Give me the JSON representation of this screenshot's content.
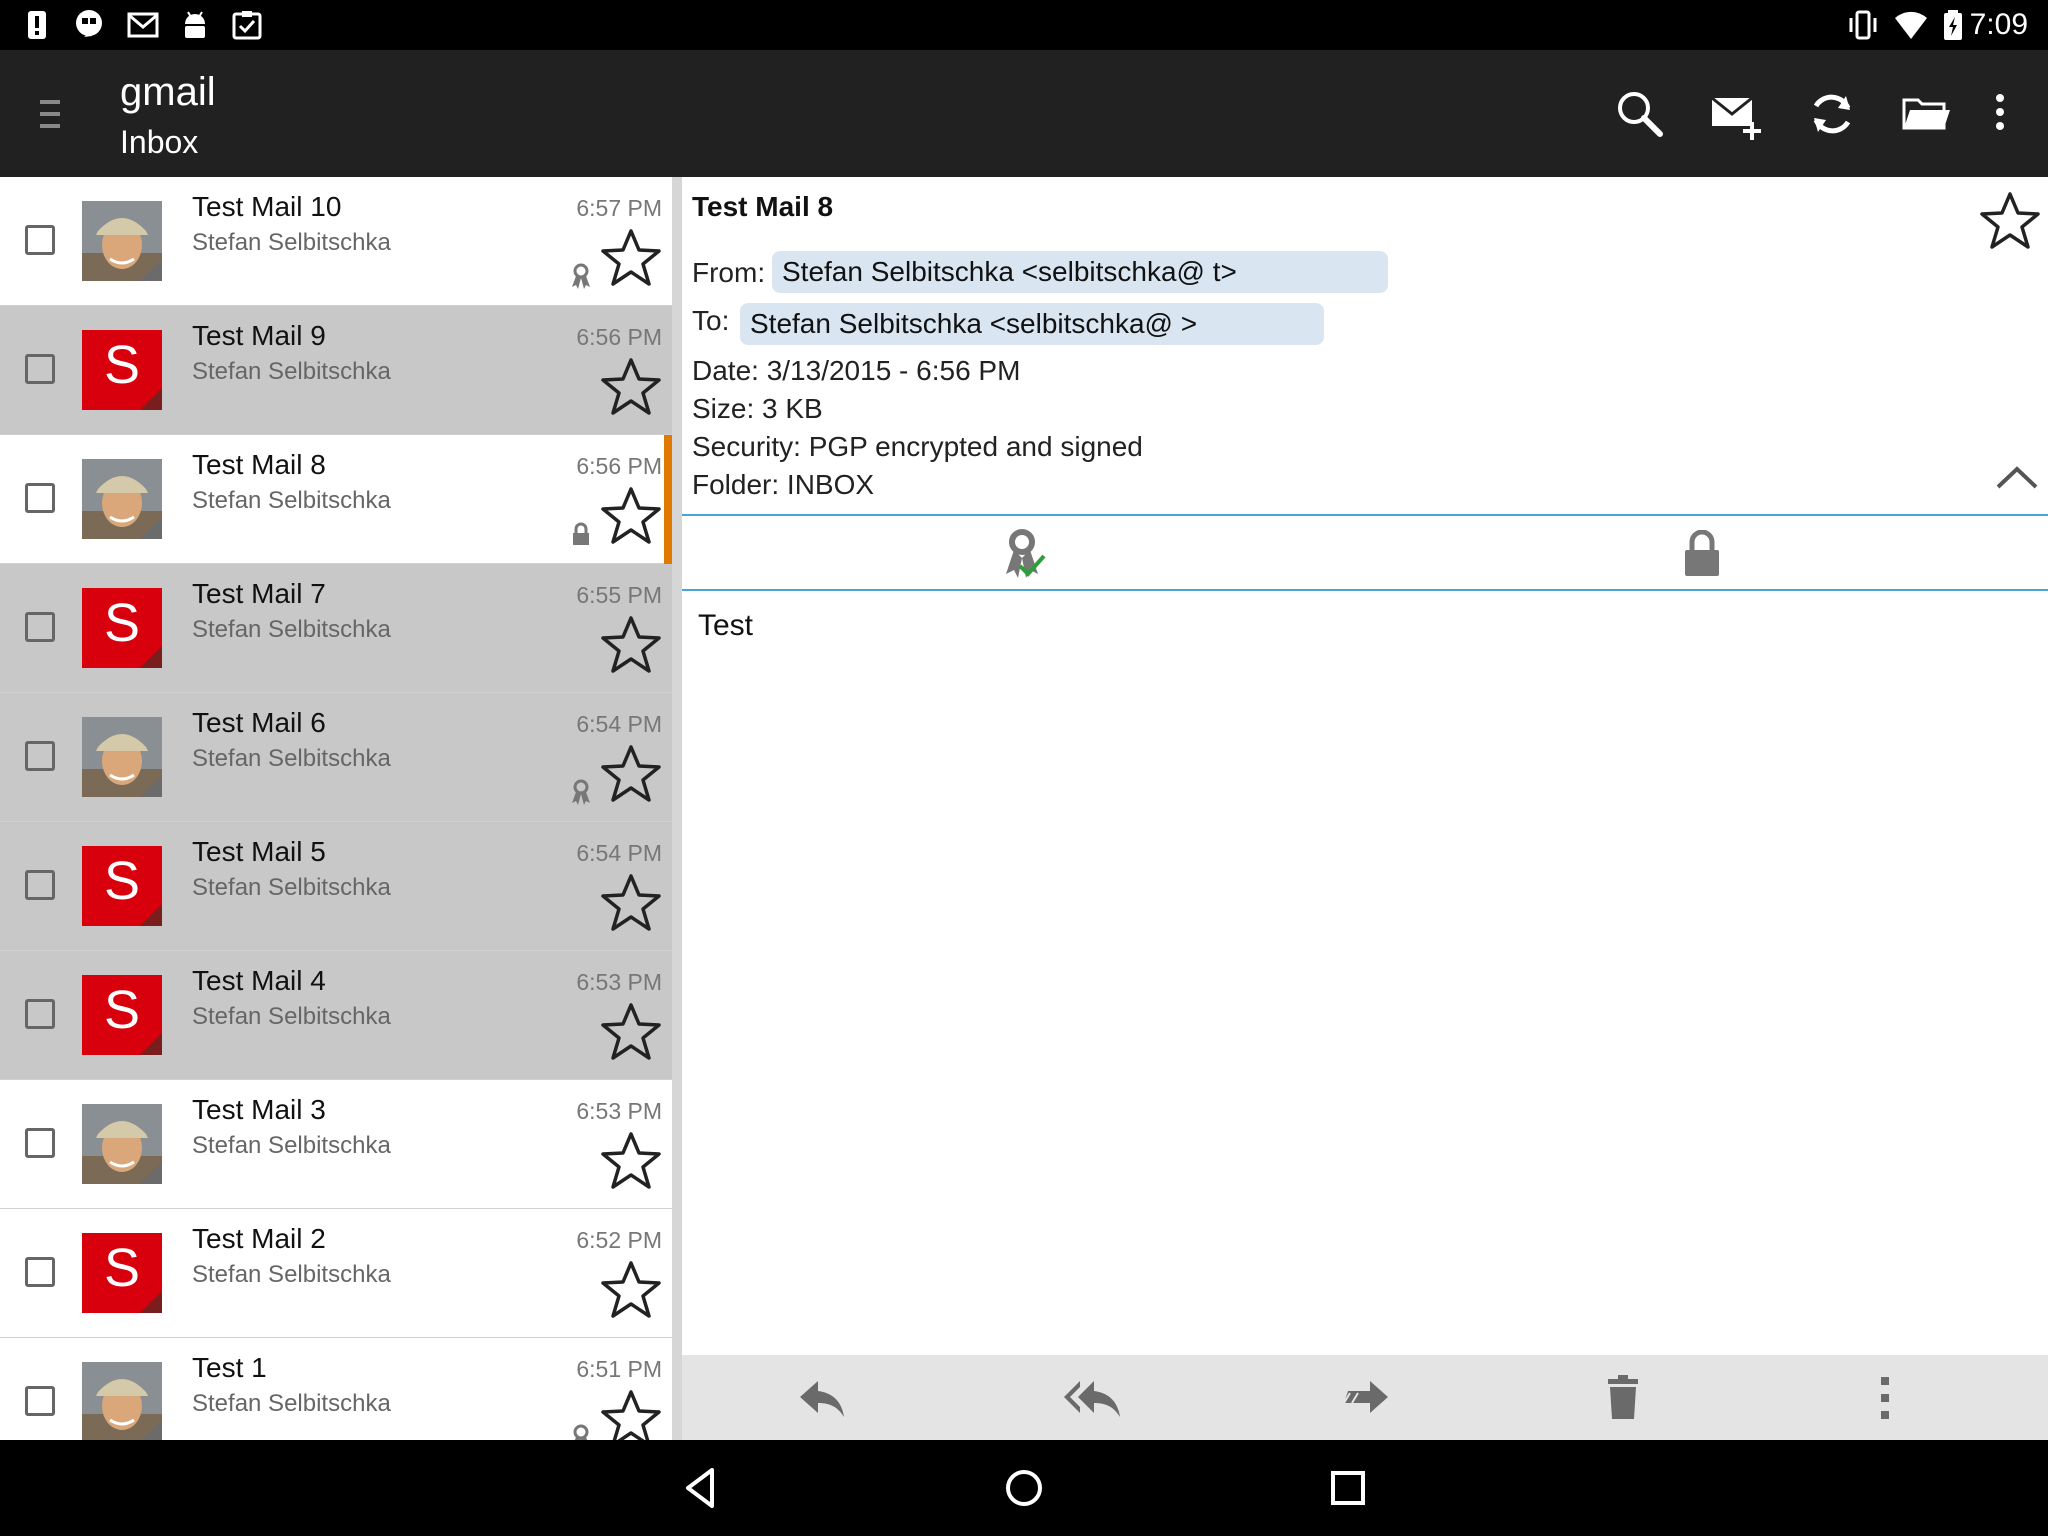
{
  "status_bar": {
    "time": "7:09",
    "left_icons": [
      "alert-icon",
      "hangouts-icon",
      "gmail-icon",
      "android-icon",
      "clipboard-icon"
    ],
    "right_icons": [
      "vibrate-icon",
      "wifi-icon",
      "battery-icon"
    ]
  },
  "action_bar": {
    "account": "gmail",
    "folder": "Inbox",
    "actions": [
      "search-icon",
      "compose-icon",
      "refresh-icon",
      "folder-icon",
      "overflow-icon"
    ]
  },
  "messages": [
    {
      "subject": "Test Mail 10",
      "sender": "Stefan Selbitschka",
      "time": "6:57 PM",
      "avatar": "photo",
      "state": "unread",
      "badge": "certificate"
    },
    {
      "subject": "Test Mail 9",
      "sender": "Stefan Selbitschka",
      "time": "6:56 PM",
      "avatar": "letter",
      "letter": "S",
      "state": "read",
      "badge": ""
    },
    {
      "subject": "Test Mail 8",
      "sender": "Stefan Selbitschka",
      "time": "6:56 PM",
      "avatar": "photo",
      "state": "active",
      "badge": "lock"
    },
    {
      "subject": "Test Mail 7",
      "sender": "Stefan Selbitschka",
      "time": "6:55 PM",
      "avatar": "letter",
      "letter": "S",
      "state": "read",
      "badge": ""
    },
    {
      "subject": "Test Mail 6",
      "sender": "Stefan Selbitschka",
      "time": "6:54 PM",
      "avatar": "photo",
      "state": "read",
      "badge": "certificate"
    },
    {
      "subject": "Test Mail 5",
      "sender": "Stefan Selbitschka",
      "time": "6:54 PM",
      "avatar": "letter",
      "letter": "S",
      "state": "read",
      "badge": ""
    },
    {
      "subject": "Test Mail 4",
      "sender": "Stefan Selbitschka",
      "time": "6:53 PM",
      "avatar": "letter",
      "letter": "S",
      "state": "read",
      "badge": ""
    },
    {
      "subject": "Test Mail 3",
      "sender": "Stefan Selbitschka",
      "time": "6:53 PM",
      "avatar": "photo",
      "state": "unread",
      "badge": ""
    },
    {
      "subject": "Test Mail 2",
      "sender": "Stefan Selbitschka",
      "time": "6:52 PM",
      "avatar": "letter",
      "letter": "S",
      "state": "unread",
      "badge": ""
    },
    {
      "subject": "Test 1",
      "sender": "Stefan Selbitschka",
      "time": "6:51 PM",
      "avatar": "photo",
      "state": "unread",
      "badge": "certificate"
    }
  ],
  "detail": {
    "subject": "Test Mail 8",
    "from_label": "From:",
    "from_value": "Stefan Selbitschka <selbitschka@                    t>",
    "to_label": "To:",
    "to_value": "Stefan Selbitschka <selbitschka@                  >",
    "date": "Date:  3/13/2015 - 6:56 PM",
    "size": "Size:  3 KB",
    "security": "Security:   PGP encrypted and signed",
    "folder": "Folder:  INBOX",
    "body": "Test",
    "crypto_tabs": [
      "signature-verified-icon",
      "encrypted-lock-icon"
    ],
    "bottom_actions": [
      "reply-icon",
      "reply-all-icon",
      "forward-icon",
      "delete-icon",
      "more-icon"
    ]
  },
  "nav_bar": {
    "buttons": [
      "back-icon",
      "home-icon",
      "recents-icon"
    ]
  },
  "colors": {
    "action_bar": "#212121",
    "accent_blue": "#4aa3d6",
    "active_marker": "#e07900",
    "avatar_red": "#d8000c",
    "chip_bg": "#d9e6f2"
  }
}
